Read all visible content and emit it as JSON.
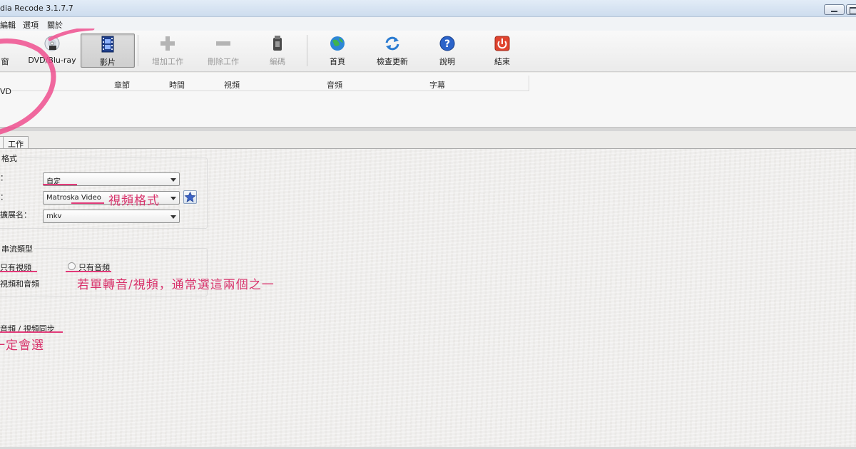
{
  "window": {
    "title": "dia Recode 3.1.7.7"
  },
  "menu": {
    "items": [
      "編輯",
      "選項",
      "關於"
    ]
  },
  "toolbar": {
    "items": [
      {
        "label": "窗",
        "icon": "window-icon",
        "state": "normal"
      },
      {
        "label": "DVD/Blu-ray",
        "icon": "dvd-disc-icon",
        "state": "normal"
      },
      {
        "label": "影片",
        "icon": "film-icon",
        "state": "active"
      },
      {
        "label": "增加工作",
        "icon": "plus-icon",
        "state": "disabled"
      },
      {
        "label": "刪除工作",
        "icon": "minus-icon",
        "state": "disabled"
      },
      {
        "label": "編碼",
        "icon": "encode-icon",
        "state": "disabled"
      },
      {
        "label": "首頁",
        "icon": "globe-icon",
        "state": "normal"
      },
      {
        "label": "檢查更新",
        "icon": "refresh-icon",
        "state": "normal"
      },
      {
        "label": "說明",
        "icon": "help-icon",
        "state": "normal"
      },
      {
        "label": "結束",
        "icon": "power-icon",
        "state": "normal"
      }
    ]
  },
  "list": {
    "columns": [
      "章節",
      "時間",
      "視頻",
      "音頻",
      "字幕"
    ],
    "row_text": "VD"
  },
  "tabs": [
    "",
    "工作"
  ],
  "format_group": {
    "title": "格式",
    "fields": [
      {
        "label": "：",
        "value": "自定"
      },
      {
        "label": "：",
        "value": "Matroska Video"
      },
      {
        "label": "擴展名：",
        "value": "mkv"
      }
    ]
  },
  "stream_group": {
    "title": "串流類型",
    "options": [
      {
        "label": "只有視頻",
        "selected": false
      },
      {
        "label": "只有音頻",
        "selected": false
      },
      {
        "label": "視頻和音頻",
        "selected": false
      }
    ]
  },
  "sync_option": {
    "label": "音頻 / 視頻同步"
  },
  "annotations": {
    "video_format": "視頻格式",
    "single_convert": "若單轉音/視頻，通常選這兩個之一",
    "always_select": "一定會選",
    "color": "#d8326b"
  }
}
